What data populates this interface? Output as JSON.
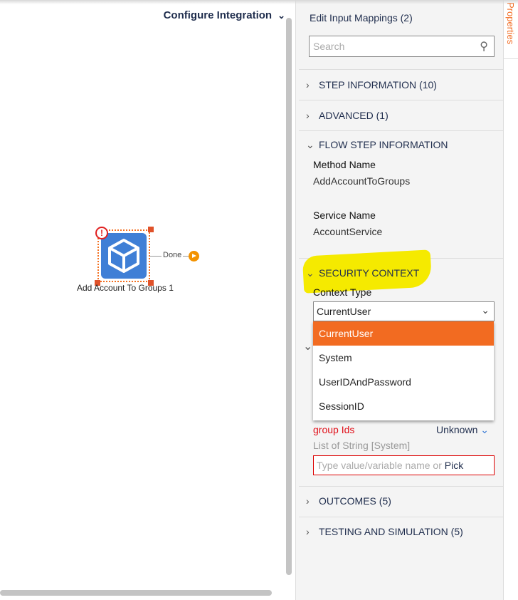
{
  "header": {
    "title": "Configure Integration",
    "chevron_icon": "chevron-down-icon"
  },
  "canvas": {
    "node": {
      "label": "Add Account To Groups 1",
      "icon": "cube-icon",
      "warning_icon": "exclamation-circle-icon",
      "color": "#3f7fd6"
    },
    "outcome": {
      "label": "Done",
      "color": "#f39200"
    }
  },
  "panel": {
    "title": "Edit Input Mappings (2)",
    "search_placeholder": "Search",
    "sections": {
      "step_info": "STEP INFORMATION (10)",
      "advanced": "ADVANCED (1)",
      "flow_step": "FLOW STEP INFORMATION",
      "security": "SECURITY CONTEXT",
      "outcomes": "OUTCOMES (5)",
      "testing": "TESTING AND SIMULATION (5)"
    },
    "flow_step": {
      "method_label": "Method Name",
      "method_value": "AddAccountToGroups",
      "service_label": "Service Name",
      "service_value": "AccountService"
    },
    "security": {
      "context_label": "Context Type",
      "selected": "CurrentUser",
      "options": [
        "CurrentUser",
        "System",
        "UserIDAndPassword",
        "SessionID"
      ]
    },
    "input": {
      "name": "group Ids",
      "type_selector": "Unknown",
      "type": "List of String [System]",
      "placeholder": "Type value/variable name or",
      "pick": "Pick"
    }
  },
  "side_tab": {
    "label": "Properties"
  },
  "colors": {
    "accent": "#f26b21",
    "highlight": "#f5ea00",
    "error": "#e0101a"
  }
}
